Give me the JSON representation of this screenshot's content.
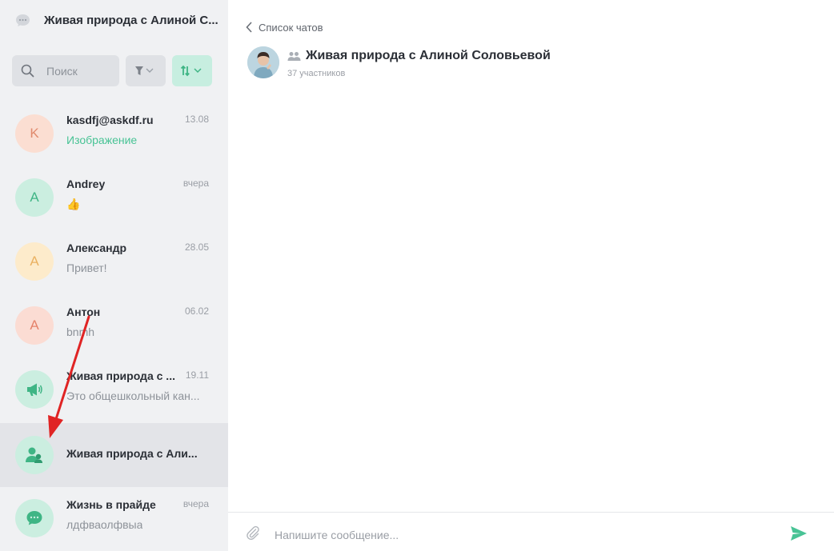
{
  "sidebar": {
    "title": "Живая природа с Алиной С...",
    "search_placeholder": "Поиск",
    "chats": [
      {
        "name": "kasdfj@askdf.ru",
        "time": "13.08",
        "preview": "Изображение",
        "avatar_letter": "K"
      },
      {
        "name": "Andrey",
        "time": "вчера",
        "preview": "👍",
        "avatar_letter": "A"
      },
      {
        "name": "Александр",
        "time": "28.05",
        "preview": "Привет!",
        "avatar_letter": "А"
      },
      {
        "name": "Антон",
        "time": "06.02",
        "preview": "bnmh",
        "avatar_letter": "А"
      },
      {
        "name": "Живая природа с ...",
        "time": "19.11",
        "preview": "Это общешкольный кан...",
        "avatar_icon": "megaphone-icon"
      },
      {
        "name": "Живая природа с Али...",
        "time": "",
        "preview": "",
        "avatar_icon": "group-icon"
      },
      {
        "name": "Жизнь в прайде",
        "time": "вчера",
        "preview": "лдфваолфвыа",
        "avatar_icon": "chat-bubble-icon"
      }
    ]
  },
  "main": {
    "back_label": "Список чатов",
    "group_title": "Живая природа с Алиной Соловьевой",
    "members": "37 участников",
    "composer_placeholder": "Напишите сообщение..."
  },
  "colors": {
    "accent": "#48c395",
    "annotation_arrow": "#e02424"
  }
}
